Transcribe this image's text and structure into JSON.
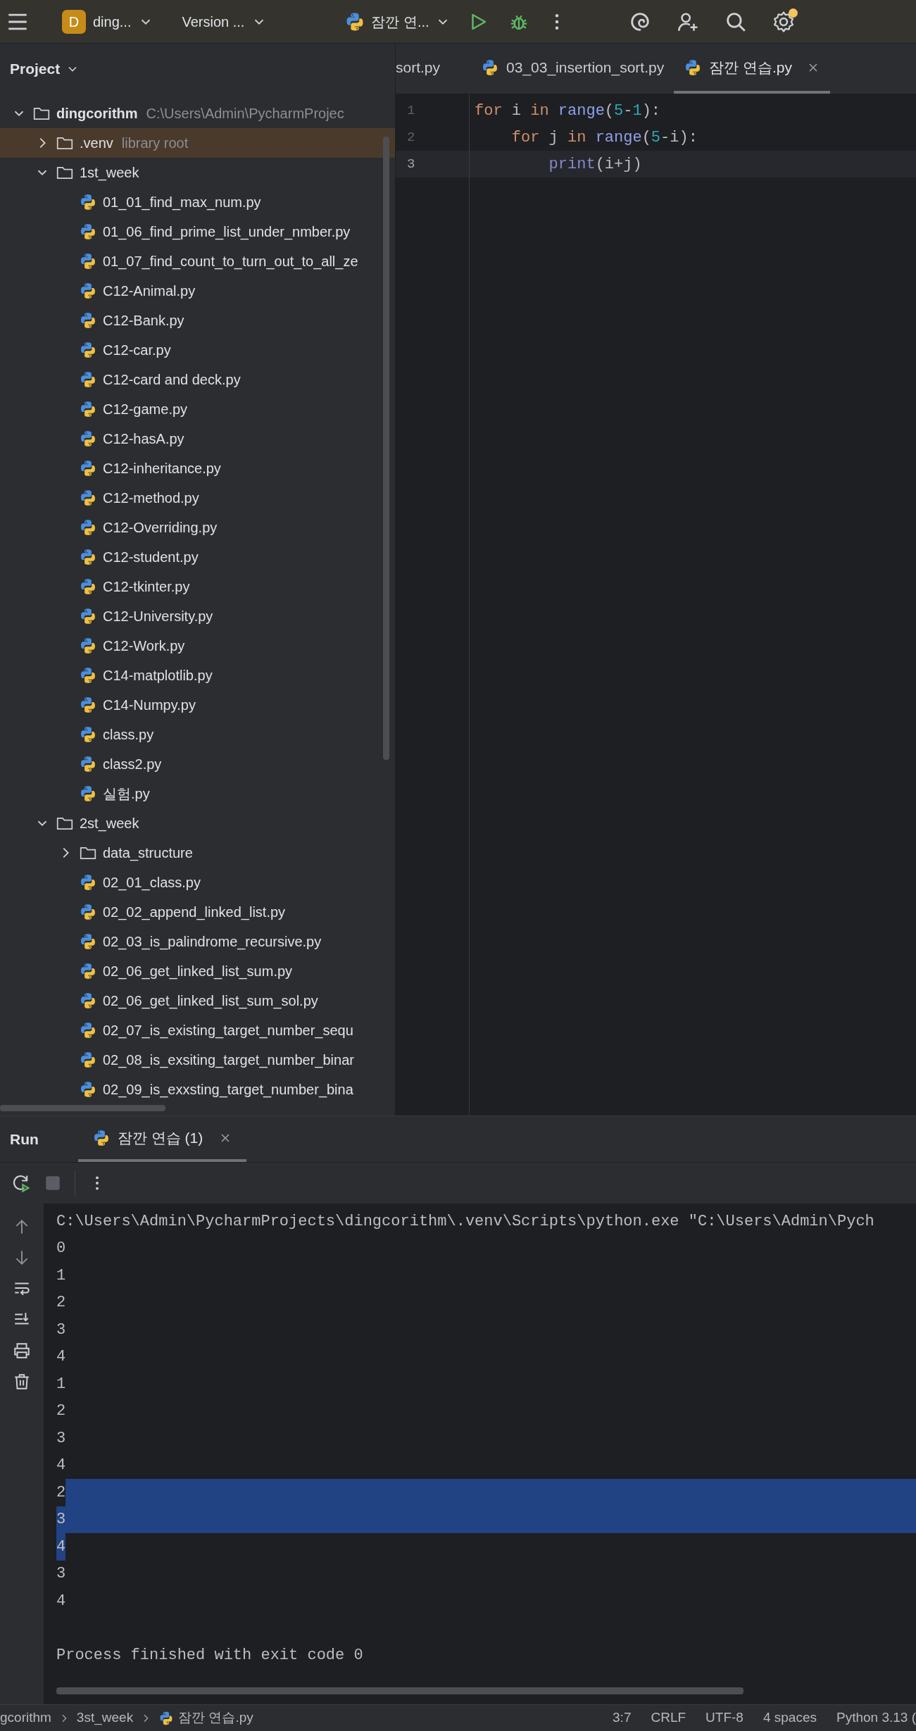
{
  "toolbar": {
    "project_badge": "D",
    "project": "ding...",
    "vcs": "Version ...",
    "run_config": "잠깐 연...",
    "settings_notification": true
  },
  "project_panel": {
    "title": "Project",
    "tree": [
      {
        "kind": "folder",
        "label": "dingcorithm",
        "note": "C:\\Users\\Admin\\PycharmProjec",
        "expanded": true,
        "selected": false,
        "children": [
          {
            "kind": "folder",
            "label": ".venv",
            "note": "library root",
            "expanded": false,
            "selected": true
          },
          {
            "kind": "folder",
            "label": "1st_week",
            "expanded": true,
            "selected": false,
            "children": [
              {
                "kind": "python",
                "label": "01_01_find_max_num.py",
                "selected": false
              },
              {
                "kind": "python",
                "label": "01_06_find_prime_list_under_nmber.py",
                "selected": false
              },
              {
                "kind": "python",
                "label": "01_07_find_count_to_turn_out_to_all_ze",
                "selected": false
              },
              {
                "kind": "python",
                "label": "C12-Animal.py",
                "selected": false
              },
              {
                "kind": "python",
                "label": "C12-Bank.py",
                "selected": false
              },
              {
                "kind": "python",
                "label": "C12-car.py",
                "selected": false
              },
              {
                "kind": "python",
                "label": "C12-card and deck.py",
                "selected": false
              },
              {
                "kind": "python",
                "label": "C12-game.py",
                "selected": false
              },
              {
                "kind": "python",
                "label": "C12-hasA.py",
                "selected": false
              },
              {
                "kind": "python",
                "label": "C12-inheritance.py",
                "selected": false
              },
              {
                "kind": "python",
                "label": "C12-method.py",
                "selected": false
              },
              {
                "kind": "python",
                "label": "C12-Overriding.py",
                "selected": false
              },
              {
                "kind": "python",
                "label": "C12-student.py",
                "selected": false
              },
              {
                "kind": "python",
                "label": "C12-tkinter.py",
                "selected": false
              },
              {
                "kind": "python",
                "label": "C12-University.py",
                "selected": false
              },
              {
                "kind": "python",
                "label": "C12-Work.py",
                "selected": false
              },
              {
                "kind": "python",
                "label": "C14-matplotlib.py",
                "selected": false
              },
              {
                "kind": "python",
                "label": "C14-Numpy.py",
                "selected": false
              },
              {
                "kind": "python",
                "label": "class.py",
                "selected": false
              },
              {
                "kind": "python",
                "label": "class2.py",
                "selected": false
              },
              {
                "kind": "python",
                "label": "실험.py",
                "selected": false
              }
            ]
          },
          {
            "kind": "folder",
            "label": "2st_week",
            "expanded": true,
            "selected": false,
            "children": [
              {
                "kind": "folder",
                "label": "data_structure",
                "expanded": false,
                "selected": false
              },
              {
                "kind": "python",
                "label": "02_01_class.py",
                "selected": false
              },
              {
                "kind": "python",
                "label": "02_02_append_linked_list.py",
                "selected": false
              },
              {
                "kind": "python",
                "label": "02_03_is_palindrome_recursive.py",
                "selected": false
              },
              {
                "kind": "python",
                "label": "02_06_get_linked_list_sum.py",
                "selected": false
              },
              {
                "kind": "python",
                "label": "02_06_get_linked_list_sum_sol.py",
                "selected": false
              },
              {
                "kind": "python",
                "label": "02_07_is_existing_target_number_sequ",
                "selected": false
              },
              {
                "kind": "python",
                "label": "02_08_is_exsiting_target_number_binar",
                "selected": false
              },
              {
                "kind": "python",
                "label": "02_09_is_exxsting_target_number_bina",
                "selected": false
              }
            ]
          }
        ]
      }
    ]
  },
  "editor": {
    "tabs": [
      {
        "label": "sort.py",
        "icon": false,
        "selected": false,
        "closable": false
      },
      {
        "label": "03_03_insertion_sort.py",
        "icon": true,
        "selected": false,
        "closable": false
      },
      {
        "label": "잠깐 연습.py",
        "icon": true,
        "selected": true,
        "closable": true
      }
    ],
    "lines": [
      {
        "number": "1",
        "current": false,
        "tokens": [
          {
            "kind": "keyword",
            "text": "for"
          },
          {
            "kind": "plain",
            "text": " i "
          },
          {
            "kind": "keyword",
            "text": "in "
          },
          {
            "kind": "call",
            "text": "range"
          },
          {
            "kind": "plain",
            "text": "("
          },
          {
            "kind": "number",
            "text": "5"
          },
          {
            "kind": "plain",
            "text": "-"
          },
          {
            "kind": "number",
            "text": "1"
          },
          {
            "kind": "plain",
            "text": "):"
          }
        ]
      },
      {
        "number": "2",
        "current": false,
        "tokens": [
          {
            "kind": "keyword",
            "text": "    for"
          },
          {
            "kind": "plain",
            "text": " j "
          },
          {
            "kind": "keyword",
            "text": "in "
          },
          {
            "kind": "call",
            "text": "range"
          },
          {
            "kind": "plain",
            "text": "("
          },
          {
            "kind": "number",
            "text": "5"
          },
          {
            "kind": "plain",
            "text": "-i):"
          }
        ]
      },
      {
        "number": "3",
        "current": true,
        "tokens": [
          {
            "kind": "builtin",
            "text": "        print"
          },
          {
            "kind": "plain",
            "text": "(i+j)"
          }
        ]
      }
    ]
  },
  "run_panel": {
    "title": "Run",
    "tab": {
      "label": "잠깐 연습 (1)",
      "selected": true
    },
    "console": [
      {
        "kind": "command",
        "text": "C:\\Users\\Admin\\PycharmProjects\\dingcorithm\\.venv\\Scripts\\python.exe \"C:\\Users\\Admin\\Pych",
        "text_selected": false,
        "line_end_selected": false
      },
      {
        "kind": "output",
        "text": "0",
        "text_selected": false,
        "line_end_selected": false
      },
      {
        "kind": "output",
        "text": "1",
        "text_selected": false,
        "line_end_selected": false
      },
      {
        "kind": "output",
        "text": "2",
        "text_selected": false,
        "line_end_selected": false
      },
      {
        "kind": "output",
        "text": "3",
        "text_selected": false,
        "line_end_selected": false
      },
      {
        "kind": "output",
        "text": "4",
        "text_selected": false,
        "line_end_selected": false
      },
      {
        "kind": "output",
        "text": "1",
        "text_selected": false,
        "line_end_selected": false
      },
      {
        "kind": "output",
        "text": "2",
        "text_selected": false,
        "line_end_selected": false
      },
      {
        "kind": "output",
        "text": "3",
        "text_selected": false,
        "line_end_selected": false
      },
      {
        "kind": "output",
        "text": "4",
        "text_selected": false,
        "line_end_selected": false
      },
      {
        "kind": "output",
        "text": "2",
        "text_selected": false,
        "line_end_selected": true
      },
      {
        "kind": "output",
        "text": "3",
        "text_selected": true,
        "line_end_selected": true
      },
      {
        "kind": "output",
        "text": "4",
        "text_selected": true,
        "line_end_selected": false
      },
      {
        "kind": "output",
        "text": "3",
        "text_selected": false,
        "line_end_selected": false
      },
      {
        "kind": "output",
        "text": "4",
        "text_selected": false,
        "line_end_selected": false
      },
      {
        "kind": "status",
        "text": "Process finished with exit code 0",
        "text_selected": false,
        "line_end_selected": false
      }
    ]
  },
  "status_bar": {
    "breadcrumbs": [
      {
        "kind": "folder",
        "label": "gcorithm"
      },
      {
        "kind": "folder",
        "label": "3st_week"
      },
      {
        "kind": "python",
        "label": "잠깐 연습.py"
      }
    ],
    "items": [
      "3:7",
      "CRLF",
      "UTF-8",
      "4 spaces",
      "Python 3.13 ("
    ]
  }
}
